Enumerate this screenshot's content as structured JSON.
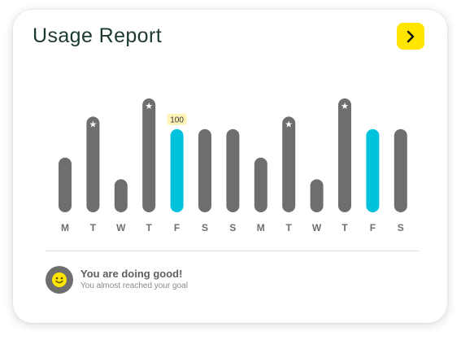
{
  "header": {
    "title": "Usage Report"
  },
  "next_icon": "chevron-right-icon",
  "colors": {
    "accent": "#ffe500",
    "highlight": "#00c2dc",
    "bar": "#6e6e6e"
  },
  "chart_data": {
    "type": "bar",
    "categories": [
      "M",
      "T",
      "W",
      "T",
      "F",
      "S",
      "S",
      "M",
      "T",
      "W",
      "T",
      "F",
      "S"
    ],
    "values": [
      48,
      84,
      29,
      100,
      73,
      73,
      73,
      48,
      84,
      29,
      100,
      73,
      73
    ],
    "highlighted": [
      false,
      false,
      false,
      false,
      true,
      false,
      false,
      false,
      false,
      false,
      false,
      true,
      false
    ],
    "starred": [
      false,
      true,
      false,
      true,
      false,
      false,
      false,
      false,
      true,
      false,
      true,
      false,
      false
    ],
    "data_labels": [
      {
        "index": 4,
        "text": "100"
      }
    ],
    "ylim": [
      0,
      100
    ],
    "grid": false
  },
  "footer": {
    "icon": "smiley-icon",
    "title": "You are doing good!",
    "subtitle": "You almost reached your goal"
  }
}
